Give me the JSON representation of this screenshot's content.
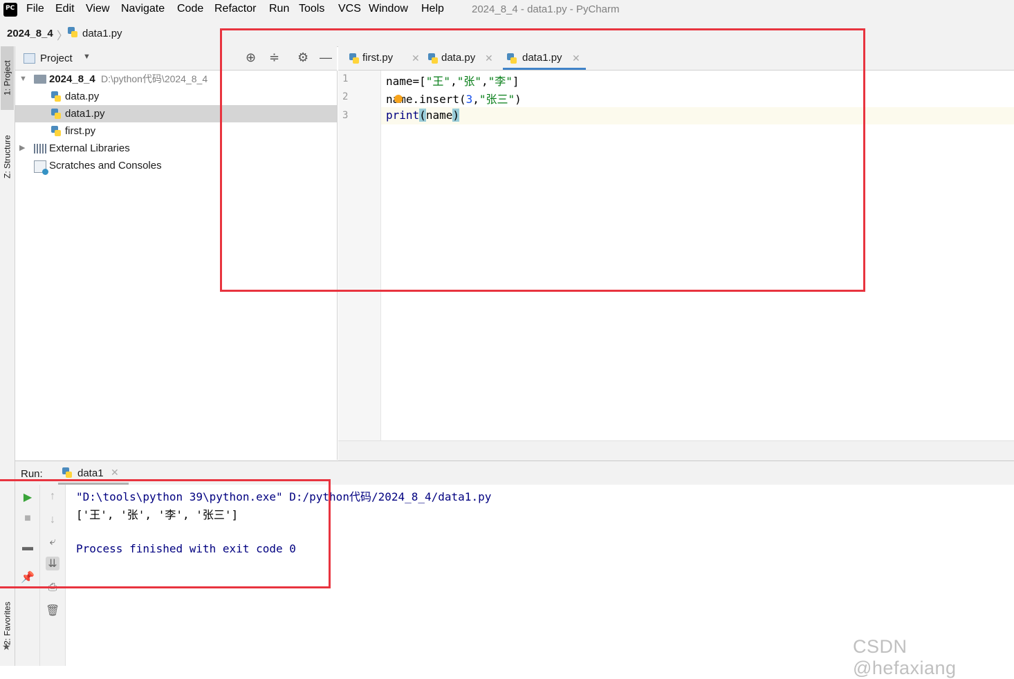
{
  "menubar": {
    "logo_text": "PC",
    "items": [
      "File",
      "Edit",
      "View",
      "Navigate",
      "Code",
      "Refactor",
      "Run",
      "Tools",
      "VCS",
      "Window",
      "Help"
    ],
    "window_title": "2024_8_4 - data1.py - PyCharm"
  },
  "breadcrumb": {
    "project": "2024_8_4",
    "file": "data1.py"
  },
  "left_stripe": {
    "project_tab": "1: Project",
    "structure_tab": "Z: Structure",
    "favorites_tab": "2: Favorites"
  },
  "project_panel": {
    "title": "Project",
    "tree": [
      {
        "name": "2024_8_4",
        "path": "D:\\python代码\\2024_8_4",
        "type": "folder"
      },
      {
        "name": "data.py",
        "type": "py"
      },
      {
        "name": "data1.py",
        "type": "py",
        "selected": true
      },
      {
        "name": "first.py",
        "type": "py"
      },
      {
        "name": "External Libraries",
        "type": "libraries"
      },
      {
        "name": "Scratches and Consoles",
        "type": "scratches"
      }
    ]
  },
  "editor": {
    "tabs": [
      {
        "label": "first.py",
        "active": false
      },
      {
        "label": "data.py",
        "active": false
      },
      {
        "label": "data1.py",
        "active": true
      }
    ],
    "line_numbers": [
      "1",
      "2",
      "3"
    ],
    "code": {
      "line1": {
        "a": "name=[",
        "s1": "\"王\"",
        "c1": ",",
        "s2": "\"张\"",
        "c2": ",",
        "s3": "\"李\"",
        "b": "]"
      },
      "line2": {
        "a": "name.insert(",
        "n": "3",
        "c": ",",
        "s": "\"张三\"",
        "b": ")"
      },
      "line3": {
        "kw": "print",
        "lp": "(",
        "arg": "name",
        "rp": ")"
      }
    }
  },
  "run_panel": {
    "label": "Run:",
    "tab": "data1",
    "console": [
      "\"D:\\tools\\python 39\\python.exe\" D:/python代码/2024_8_4/data1.py",
      "['王', '张', '李', '张三']",
      "",
      "Process finished with exit code 0"
    ]
  },
  "watermark": "CSDN @hefaxiang",
  "colors": {
    "highlight": "#e8343f",
    "accent": "#4083c9",
    "string": "#067d17",
    "keyword": "#000080"
  }
}
